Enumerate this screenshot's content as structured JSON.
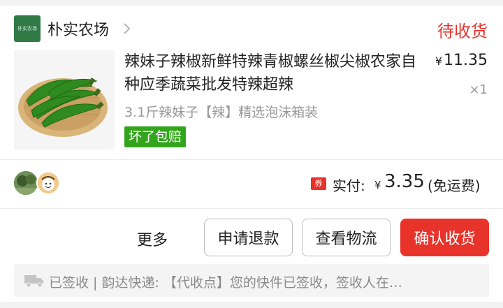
{
  "shop": {
    "logo_text": "朴实农场",
    "name": "朴实农场",
    "status": "待收货"
  },
  "product": {
    "image_icon": "green-chili-peppers-in-basket",
    "title": "辣妹子辣椒新鲜特辣青椒螺丝椒尖椒农家自种应季蔬菜批发特辣超辣",
    "currency": "¥",
    "price": "11.35",
    "quantity": "×1",
    "spec": "3.1斤辣妹子【辣】精选泡沫箱装",
    "service_tag": "坏了包赔"
  },
  "payment": {
    "coupon_icon_label": "券",
    "label": "实付:",
    "currency": "¥",
    "amount": "3.35",
    "shipping_note": "(免运费)"
  },
  "actions": {
    "more": "更多",
    "refund": "申请退款",
    "logistics": "查看物流",
    "confirm": "确认收货"
  },
  "logistics": {
    "icon": "truck-icon",
    "text": "已签收 | 韵达快递: 【代收点】您的快件已签收，签收人在…"
  },
  "colors": {
    "accent": "#e8332b",
    "tag_green": "#33a51c",
    "shop_logo": "#2f7a45",
    "muted_text": "#999999"
  }
}
